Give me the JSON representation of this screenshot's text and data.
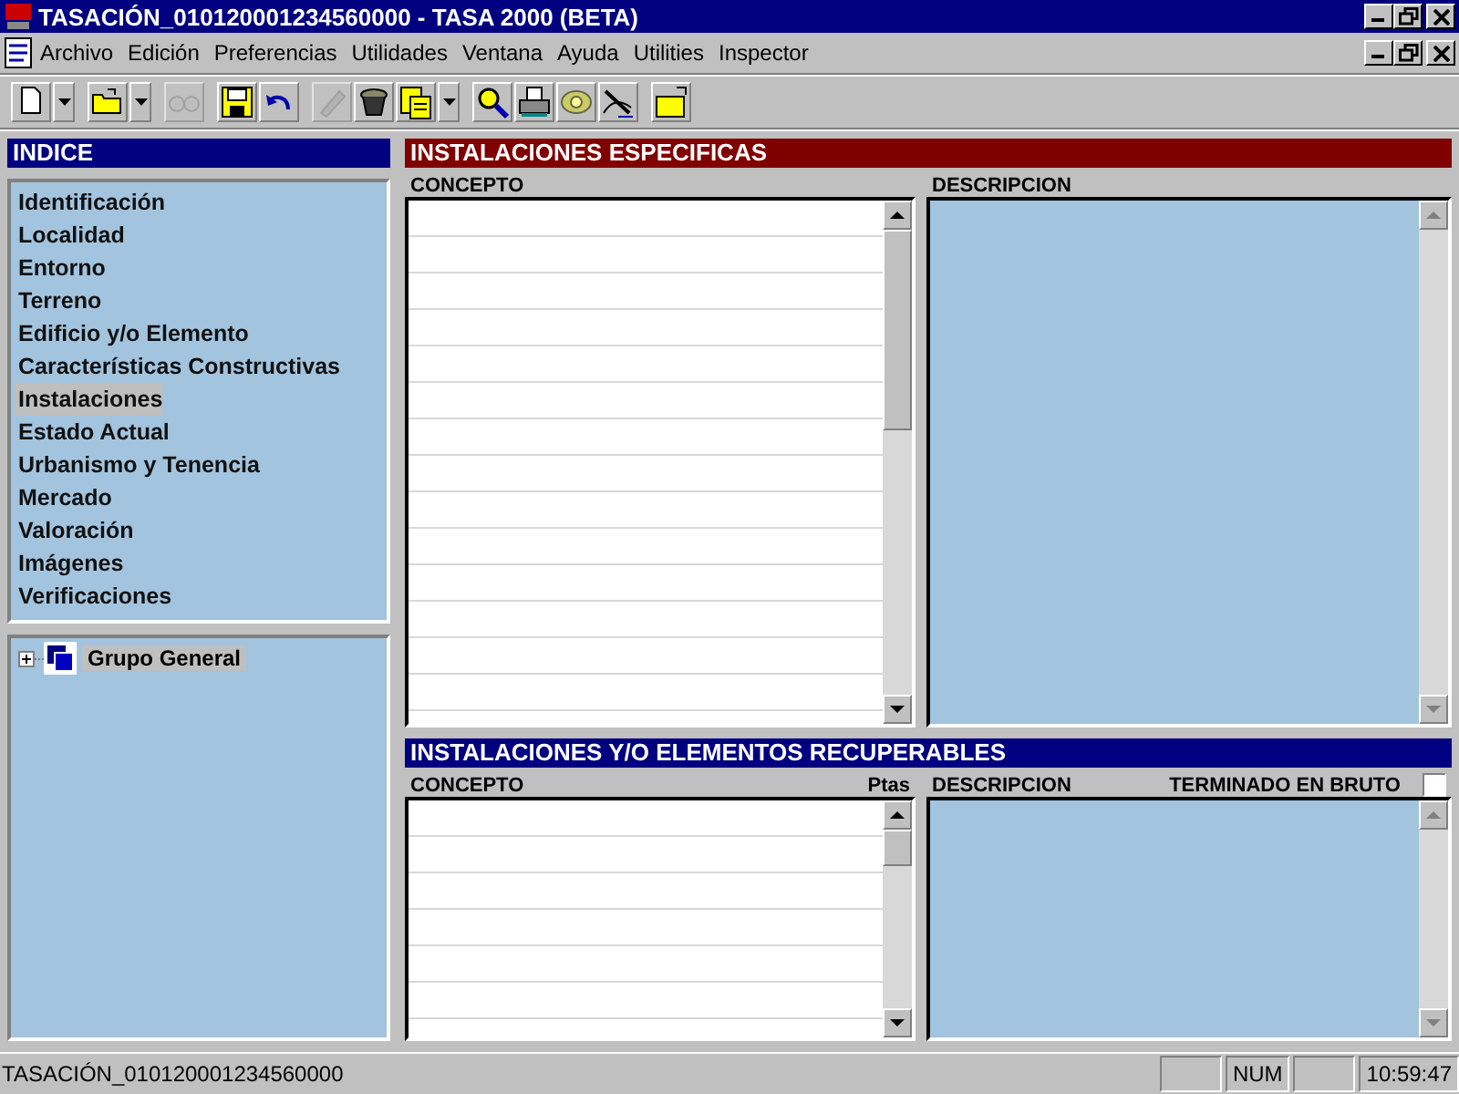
{
  "window": {
    "title": "TASACIÓN_010120001234560000 - TASA 2000 (BETA)"
  },
  "menu": [
    "Archivo",
    "Edición",
    "Preferencias",
    "Utilidades",
    "Ventana",
    "Ayuda",
    "Utilities",
    "Inspector"
  ],
  "toolbar": [
    [
      {
        "kind": "page",
        "disabled": false
      },
      {
        "kind": "drop"
      }
    ],
    [
      {
        "kind": "folder",
        "disabled": false
      },
      {
        "kind": "drop"
      }
    ],
    [
      {
        "kind": "binoculars",
        "disabled": true
      }
    ],
    [
      {
        "kind": "disk",
        "disabled": false
      },
      {
        "kind": "undo",
        "disabled": false
      }
    ],
    [
      {
        "kind": "pencil",
        "disabled": true
      },
      {
        "kind": "bin",
        "disabled": false
      },
      {
        "kind": "paste",
        "disabled": false
      },
      {
        "kind": "drop"
      }
    ],
    [
      {
        "kind": "search",
        "disabled": false
      },
      {
        "kind": "printer",
        "disabled": false
      },
      {
        "kind": "phone",
        "disabled": false
      },
      {
        "kind": "pen",
        "disabled": false
      }
    ],
    [
      {
        "kind": "newfolder",
        "disabled": false
      }
    ]
  ],
  "sidebar": {
    "title": "INDICE",
    "items": [
      {
        "label": "Identificación",
        "selected": false
      },
      {
        "label": "Localidad",
        "selected": false
      },
      {
        "label": "Entorno",
        "selected": false
      },
      {
        "label": "Terreno",
        "selected": false
      },
      {
        "label": "Edificio y/o Elemento",
        "selected": false
      },
      {
        "label": "Características Constructivas",
        "selected": false
      },
      {
        "label": "Instalaciones",
        "selected": true
      },
      {
        "label": "Estado Actual",
        "selected": false
      },
      {
        "label": "Urbanismo y Tenencia",
        "selected": false
      },
      {
        "label": "Mercado",
        "selected": false
      },
      {
        "label": "Valoración",
        "selected": false
      },
      {
        "label": "Imágenes",
        "selected": false
      },
      {
        "label": "Verificaciones",
        "selected": false
      }
    ],
    "tree": [
      {
        "label": "Grupo General",
        "expanded": false
      }
    ]
  },
  "sections": [
    {
      "title": "INSTALACIONES ESPECIFICAS",
      "color": "#800000",
      "concept": "CONCEPTO",
      "description": "DESCRIPCION"
    },
    {
      "title": "INSTALACIONES Y/O ELEMENTOS RECUPERABLES",
      "color": "#000080",
      "concept": "CONCEPTO",
      "extra": "Ptas",
      "description": "DESCRIPCION",
      "check": {
        "label": "TERMINADO EN BRUTO",
        "checked": false
      }
    }
  ],
  "status_bar": {
    "text": "TASACIÓN_010120001234560000",
    "panels": [
      {
        "kind": "blank"
      },
      {
        "kind": "text",
        "text": "NUM"
      },
      {
        "kind": "blank"
      },
      {
        "kind": "text",
        "text": "10:59:47"
      }
    ]
  }
}
